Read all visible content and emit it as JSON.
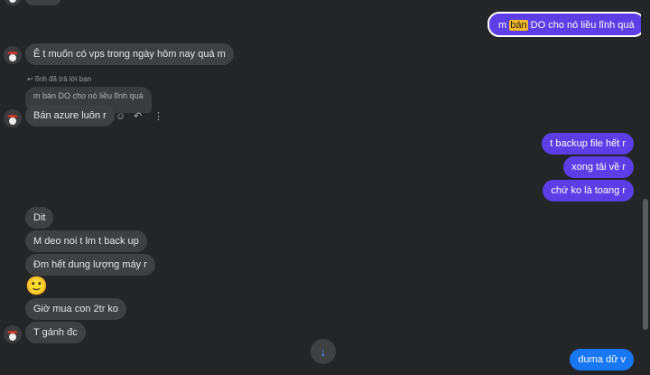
{
  "messages": {
    "top_outgoing_pre": "m ",
    "top_outgoing_hl": "bán",
    "top_outgoing_post": " DO cho nó liều lĩnh quá",
    "msg1": "Ê t muốn có vps trong ngày hôm nay quá m",
    "reply_label": "lĩnh đã trả lời bạn",
    "reply_preview": "m bán DO cho nó liều lĩnh quá",
    "msg2": "Bán azure luôn r",
    "out1": "t backup file hết r",
    "out2": "xong tải về r",
    "out3": "chứ ko là toang r",
    "msg3": "Dit",
    "msg4": "M deo noi t lm t back up",
    "msg5": "Đm hết dung lượng máy r",
    "emoji": "🙂",
    "msg6": "Giờ mua con 2tr ko",
    "msg7": "T gánh đc",
    "last_out": "duma dữ v"
  },
  "icons": {
    "reply_arrow": "↩",
    "react": "☺",
    "reply": "↶",
    "more": "⋮",
    "scroll_down": "↓"
  },
  "colors": {
    "outgoing": "#5b3ee6",
    "outgoing_blue": "#1877f2",
    "incoming": "#3e4042",
    "highlight": "#f7b928"
  }
}
